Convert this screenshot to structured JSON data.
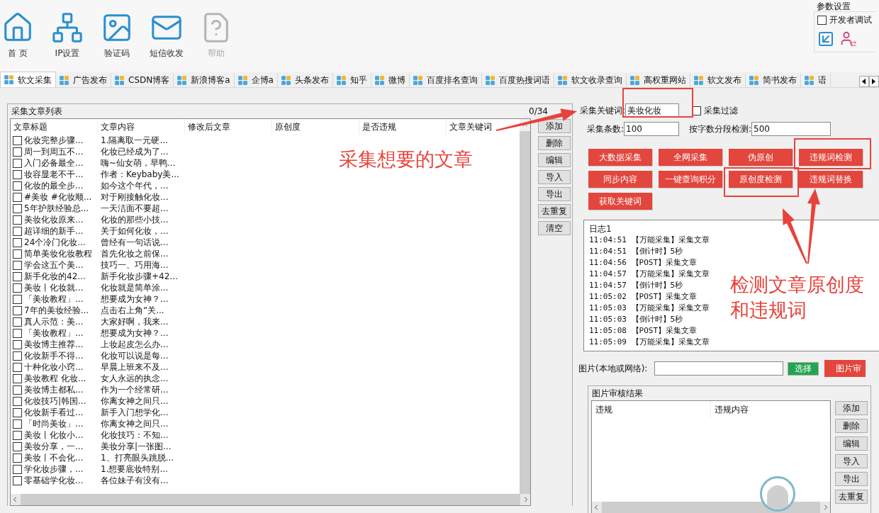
{
  "toolbar": [
    {
      "label": "首 页",
      "kind": "home",
      "disabled": false
    },
    {
      "label": "IP设置",
      "kind": "network",
      "disabled": false
    },
    {
      "label": "验证码",
      "kind": "image",
      "disabled": false
    },
    {
      "label": "短信收发",
      "kind": "mail",
      "disabled": false
    },
    {
      "label": "帮助",
      "kind": "help",
      "disabled": true
    }
  ],
  "settings": {
    "title": "参数设置",
    "checkbox": {
      "label": "开发者调试",
      "checked": false
    }
  },
  "tabs": [
    {
      "label": "软文采集",
      "selected": true
    },
    {
      "label": "广告发布",
      "selected": false
    },
    {
      "label": "CSDN博客",
      "selected": false
    },
    {
      "label": "新浪博客a",
      "selected": false
    },
    {
      "label": "企博a",
      "selected": false
    },
    {
      "label": "头条发布",
      "selected": false
    },
    {
      "label": "知乎",
      "selected": false
    },
    {
      "label": "微博",
      "selected": false
    },
    {
      "label": "百度排名查询",
      "selected": false
    },
    {
      "label": "百度热搜词语",
      "selected": false
    },
    {
      "label": "软文收录查询",
      "selected": false
    },
    {
      "label": "高权重网站",
      "selected": false
    },
    {
      "label": "软文发布",
      "selected": false
    },
    {
      "label": "简书发布",
      "selected": false
    },
    {
      "label": "语",
      "selected": false
    }
  ],
  "article_list": {
    "title": "采集文章列表",
    "count": "0/34",
    "columns": [
      "文章标题",
      "文章内容",
      "修改后文章",
      "原创度",
      "是否违规",
      "文章关键词"
    ],
    "rows": [
      {
        "title": "化妆完整步骤...",
        "content": "1.隔离取一元硬...",
        "checked": false
      },
      {
        "title": "周一到周五不...",
        "content": "化妆已经成为了...",
        "checked": false
      },
      {
        "title": "入门必备最全...",
        "content": "嗨~仙女萌，早鸭...",
        "checked": false
      },
      {
        "title": "妆容显老不干...",
        "content": "作者：Keybaby美...",
        "checked": false
      },
      {
        "title": "化妆的最全步...",
        "content": "如今这个年代，...",
        "checked": false
      },
      {
        "title": "#美妆 #化妆顺...",
        "content": "对于刚接触化妆...",
        "checked": false
      },
      {
        "title": "5年护肤经验总...",
        "content": "一天洁面不要超...",
        "checked": false
      },
      {
        "title": "美妆化妆原来...",
        "content": "化妆的那些小技...",
        "checked": false
      },
      {
        "title": "超详细的新手...",
        "content": "关于如何化妆，...",
        "checked": false
      },
      {
        "title": "24个冷门化妆...",
        "content": "曾经有一句话说...",
        "checked": false
      },
      {
        "title": "简单美妆化妆教程",
        "content": "首先化妆之前保...",
        "checked": false
      },
      {
        "title": "学会这五个美...",
        "content": "技巧一、巧用海...",
        "checked": false
      },
      {
        "title": "新手化妆的42...",
        "content": "新手化妆步骤+42...",
        "checked": false
      },
      {
        "title": "美妆丨化妆就...",
        "content": "化妆就是简单涂...",
        "checked": false
      },
      {
        "title": "「美妆教程」...",
        "content": "想要成为女神？...",
        "checked": false
      },
      {
        "title": "7年的美妆经验...",
        "content": "点击右上角“关...",
        "checked": false
      },
      {
        "title": "真人示范：美...",
        "content": "大家好啊，我来...",
        "checked": false
      },
      {
        "title": "「美妆教程」...",
        "content": "想要成为女神？...",
        "checked": false
      },
      {
        "title": "美妆博主推荐...",
        "content": "上妆起皮怎么办...",
        "checked": false
      },
      {
        "title": "化妆新手不得...",
        "content": "化妆可以说是每...",
        "checked": false
      },
      {
        "title": "十种化妆小窍...",
        "content": "早晨上班来不及...",
        "checked": false
      },
      {
        "title": "美妆教程 化妆...",
        "content": "女人永远的执念...",
        "checked": false
      },
      {
        "title": "美妆博主都私...",
        "content": "作为一个经常研...",
        "checked": false
      },
      {
        "title": "化妆技巧|韩国...",
        "content": "你离女神之间只...",
        "checked": false
      },
      {
        "title": "化妆新手看过...",
        "content": "新手入门想学化...",
        "checked": false
      },
      {
        "title": "「时尚美妆」...",
        "content": "你离女神之间只...",
        "checked": false
      },
      {
        "title": "美妆丨化妆小...",
        "content": "化妆技巧：不知...",
        "checked": false
      },
      {
        "title": "美妆分享，一...",
        "content": "美妆分享|一张图...",
        "checked": false
      },
      {
        "title": "美妆丨不会化...",
        "content": "1、打亮眼头跳脱...",
        "checked": false
      },
      {
        "title": "学化妆步骤，...",
        "content": "1.想要底妆特别...",
        "checked": false
      },
      {
        "title": "零基础学化妆...",
        "content": "各位妹子有没有...",
        "checked": false
      }
    ],
    "buttons": [
      "添加",
      "删除",
      "编辑",
      "导入",
      "导出",
      "去重复",
      "清空"
    ]
  },
  "collect_form": {
    "keyword_label": "采集关键词:",
    "keyword": "美妆化妆",
    "filter": {
      "label": "采集过滤",
      "checked": false
    },
    "count_label": "采集条数:",
    "count": "100",
    "segment_label": "按字数分段检测:",
    "segment": "500"
  },
  "action_buttons": [
    "大数据采集",
    "全网采集",
    "伪原创",
    "违规词检测",
    "同步内容",
    "一键查询积分",
    "原创度检测",
    "违规词替换",
    "获取关键词"
  ],
  "log": {
    "title": "日志1",
    "lines": [
      "11:04:51 【万能采集】采集文章",
      "11:04:51 【倒计时】5秒",
      "11:04:56 【POST】采集文章",
      "11:04:57 【万能采集】采集文章",
      "11:04:57 【倒计时】5秒",
      "11:05:02 【POST】采集文章",
      "11:05:03 【万能采集】采集文章",
      "11:05:03 【倒计时】5秒",
      "11:05:08 【POST】采集文章",
      "11:05:09 【万能采集】采集文章"
    ]
  },
  "image_input": {
    "label": "图片(本地或网络):",
    "select_button": "选择",
    "audit_button": "图片审"
  },
  "image_results": {
    "title": "图片审核结果",
    "columns": [
      "违规",
      "违规内容"
    ],
    "buttons": [
      "添加",
      "删除",
      "编辑",
      "导入",
      "导出",
      "去重复"
    ]
  },
  "annotations": [
    {
      "lines": [
        "采集想要的文章"
      ]
    },
    {
      "lines": [
        "检测文章原创度",
        "和违规词"
      ]
    }
  ]
}
